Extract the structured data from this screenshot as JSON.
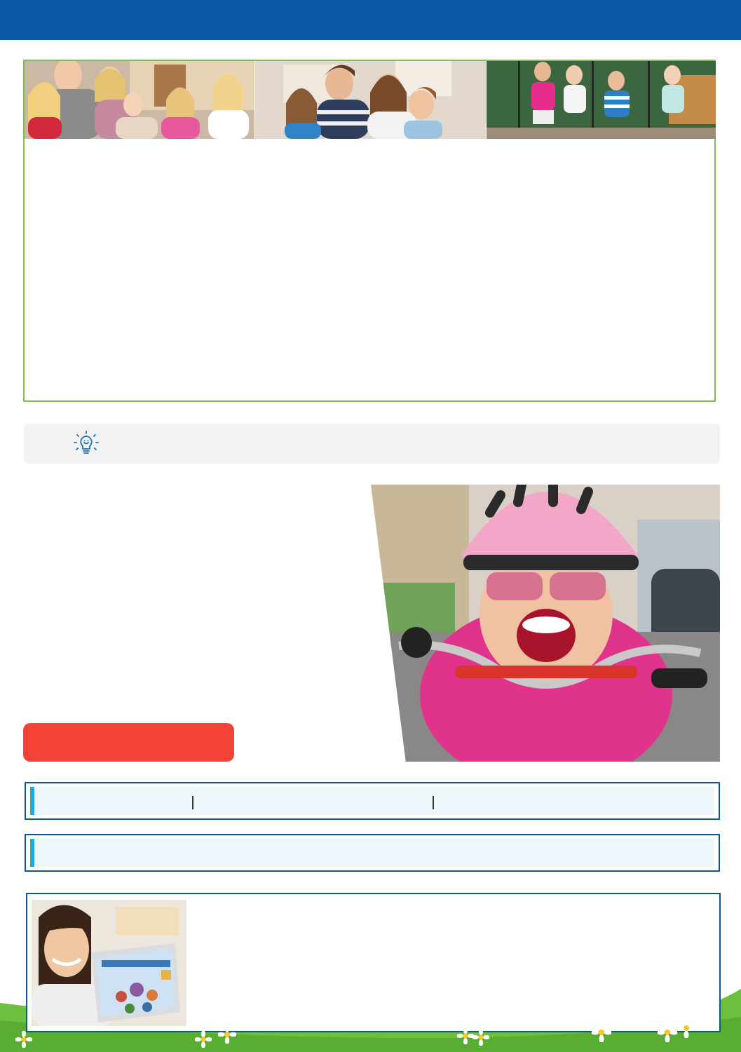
{
  "colors": {
    "header_blue": "#0a57a6",
    "box_green": "#7cc04b",
    "accent_red": "#f44336",
    "accent_cyan": "#1fa8e0",
    "tip_gray": "#f2f2f2",
    "grass_green": "#6cbf3f"
  },
  "header": {
    "title": ""
  },
  "hero": {
    "photos": [
      "family-group-photo",
      "parents-with-children-photo",
      "children-running-photo"
    ],
    "body_text": ""
  },
  "tip": {
    "icon": "lightbulb-icon",
    "text": ""
  },
  "feature": {
    "text": "",
    "photo": "girl-on-bike-photo",
    "button_label": ""
  },
  "info_rows": [
    {
      "items": [
        "",
        "",
        ""
      ]
    },
    {
      "items": [
        ""
      ]
    }
  ],
  "bottom_panel": {
    "photo": "woman-with-laptop-photo",
    "text": ""
  },
  "decor": {
    "icon": "daisy-icon"
  }
}
